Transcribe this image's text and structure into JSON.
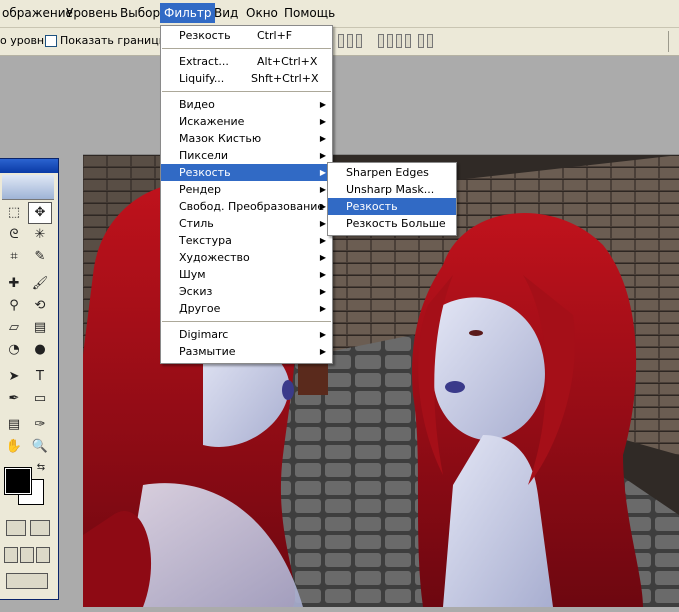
{
  "menubar": {
    "items": [
      {
        "label": "ображение"
      },
      {
        "label": "Уровень"
      },
      {
        "label": "Выбор"
      },
      {
        "label": "Фильтр",
        "active": true
      },
      {
        "label": "Вид"
      },
      {
        "label": "Окно"
      },
      {
        "label": "Помощь"
      }
    ]
  },
  "options": {
    "levels_label": "о уровня",
    "show_bounds_label": "Показать границы"
  },
  "filter_menu": {
    "last_filter": "Резкость",
    "last_filter_shortcut": "Ctrl+F",
    "extract": "Extract...",
    "extract_shortcut": "Alt+Ctrl+X",
    "liquify": "Liquify...",
    "liquify_shortcut": "Shft+Ctrl+X",
    "items": [
      {
        "label": "Видео"
      },
      {
        "label": "Искажение"
      },
      {
        "label": "Мазок Кистью"
      },
      {
        "label": "Пиксели"
      },
      {
        "label": "Резкость"
      },
      {
        "label": "Рендер"
      },
      {
        "label": "Свобод. Преобразование"
      },
      {
        "label": "Стиль"
      },
      {
        "label": "Текстура"
      },
      {
        "label": "Художество"
      },
      {
        "label": "Шум"
      },
      {
        "label": "Эскиз"
      },
      {
        "label": "Другое"
      }
    ],
    "digimarc": "Digimarc",
    "blur": "Размытие",
    "highlighted": "Резкость"
  },
  "sharpen_submenu": {
    "items": [
      {
        "label": "Sharpen Edges"
      },
      {
        "label": "Unsharp Mask..."
      },
      {
        "label": "Резкость"
      },
      {
        "label": "Резкость Больше"
      }
    ],
    "highlighted": "Резкость"
  },
  "tools": {
    "type_tool_glyph": "T",
    "selected_tool": "move-tool"
  },
  "colors": {
    "menu_highlight": "#316ac5",
    "menubar_bg": "#ece9d8",
    "hair": "#8b0a12",
    "skin": "#c9cde6"
  }
}
